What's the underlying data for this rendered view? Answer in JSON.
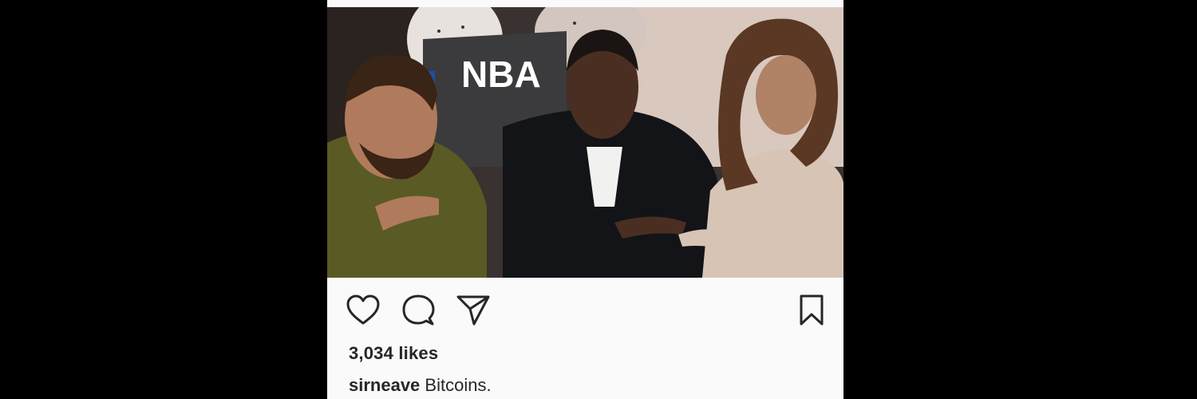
{
  "post": {
    "photo": {
      "seat_text": "NBA"
    },
    "actions": {
      "like_icon": "heart-icon",
      "comment_icon": "comment-icon",
      "share_icon": "paper-plane-icon",
      "save_icon": "bookmark-icon"
    },
    "likes_text": "3,034 likes",
    "caption": {
      "username": "sirneave",
      "text": "Bitcoins."
    }
  }
}
